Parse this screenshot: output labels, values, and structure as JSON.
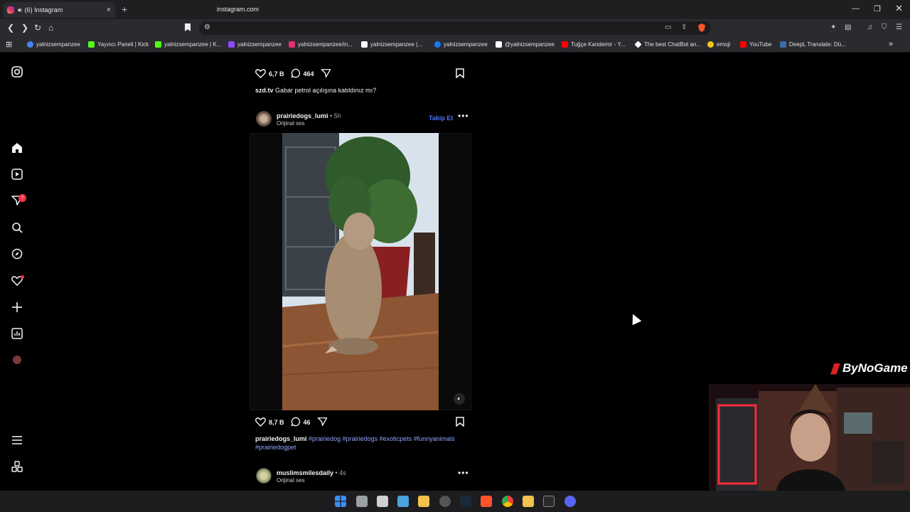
{
  "browser": {
    "tab_title": "(6) Instagram",
    "url": "instagram.com",
    "bookmarks": [
      {
        "label": "yalnizsempanzee",
        "icon": "google-icon",
        "color": "#4285f4"
      },
      {
        "label": "Yayıncı Paneli | Kick",
        "icon": "kick-icon",
        "color": "#53fc18"
      },
      {
        "label": "yalnizsempanzee | K...",
        "icon": "kick-icon",
        "color": "#53fc18"
      },
      {
        "label": "yalnizsempanzee",
        "icon": "twitch-icon",
        "color": "#9146ff"
      },
      {
        "label": "yalnizsempanzee/in...",
        "icon": "instagram-icon",
        "color": "#e1306c"
      },
      {
        "label": "yalnizsempanzee (...",
        "icon": "tiktok-icon",
        "color": "#ffffff"
      },
      {
        "label": "yalnizsempanzee",
        "icon": "facebook-icon",
        "color": "#1877f2"
      },
      {
        "label": "@yalnizsempanzee",
        "icon": "x-icon",
        "color": "#ffffff"
      },
      {
        "label": "Tuğçe Kandemir - Y...",
        "icon": "youtube-icon",
        "color": "#ff0000"
      },
      {
        "label": "The best ChatBot an...",
        "icon": "chatbot-icon",
        "color": "#ffffff"
      },
      {
        "label": "emoji",
        "icon": "emoji-icon",
        "color": "#f5c518"
      },
      {
        "label": "YouTube",
        "icon": "youtube-icon",
        "color": "#ff0000"
      },
      {
        "label": "DeepL Translate: Dü...",
        "icon": "deepl-icon",
        "color": "#0f2b46"
      }
    ]
  },
  "sidebar": {
    "notifications_badge": "7"
  },
  "post1": {
    "likes": "6,7 B",
    "comments": "464",
    "caption_user": "szd.tv",
    "caption_text": "Gabar petrol açılışına katıldınız mı?"
  },
  "post2": {
    "username": "prairiedogs_lumi",
    "time": "• 5h",
    "audio": "Orijinal ses",
    "follow_label": "Takip Et",
    "likes": "8,7 B",
    "comments": "46",
    "caption_user": "prairiedogs_lumi",
    "hashtags_line1": "#prairiedog #prairiedogs #exoticpets #funnyanimals",
    "hashtags_line2": "#prairiedogpet"
  },
  "post3": {
    "username": "muslimsmilesdaily",
    "time": "• 4s",
    "audio": "Orijinal ses"
  },
  "overlay": {
    "logo_text": "ByNoGame"
  },
  "colors": {
    "accent_link": "#4a74ff",
    "hashtag": "#8ea6ff",
    "badge": "#ff3040"
  }
}
